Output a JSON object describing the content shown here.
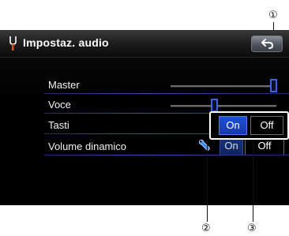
{
  "header": {
    "title": "Impostaz. audio",
    "back_icon": "back-arrow-icon",
    "menu_icon": "tuning-fork-icon"
  },
  "rows": {
    "master": {
      "label": "Master",
      "level": 0.95
    },
    "voce": {
      "label": "Voce",
      "level": 0.4
    },
    "tasti": {
      "label": "Tasti",
      "on_label": "On",
      "off_label": "Off",
      "selected": "On"
    },
    "volume_dinamico": {
      "label": "Volume dinamico",
      "on_label": "On",
      "off_label": "Off",
      "settings_icon": "wrench-icon"
    }
  },
  "callouts": {
    "c1": "①",
    "c2": "②",
    "c3": "③"
  },
  "colors": {
    "accent": "#1f4fd9",
    "row_line": "#3550b8",
    "screen_bg": "#000000"
  }
}
